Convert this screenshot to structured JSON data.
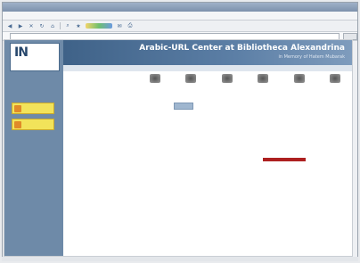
{
  "browser": {
    "title": "",
    "menu": [
      "",
      "",
      "",
      "",
      "",
      ""
    ],
    "address": "",
    "go_label": ""
  },
  "site": {
    "logo_text": "IN",
    "header_title": "Arabic-URL Center at Bibliotheca Alexandrina",
    "header_subtitle": "in Memory of Hatem Mubarak",
    "subnav": ""
  },
  "sidebar": {
    "text": "",
    "buttons": [
      {
        "label": "",
        "icon": "orange-document-icon"
      },
      {
        "label": "",
        "icon": "orange-document-icon"
      }
    ]
  },
  "content": {
    "icons": [
      {
        "label": ""
      },
      {
        "label": ""
      },
      {
        "label": ""
      },
      {
        "label": ""
      },
      {
        "label": ""
      },
      {
        "label": ""
      }
    ],
    "lines": [
      "",
      "",
      "",
      "",
      "",
      ""
    ],
    "button_label": "",
    "paragraphs": [
      "",
      "",
      "",
      "",
      "",
      ""
    ]
  },
  "statusbar": {
    "text": ""
  },
  "colors": {
    "header_blue": "#3f6288",
    "sidebar_blue": "#6e8aa8",
    "sidebar_button_yellow": "#f2e35a",
    "highlight_red": "#ad2020"
  }
}
